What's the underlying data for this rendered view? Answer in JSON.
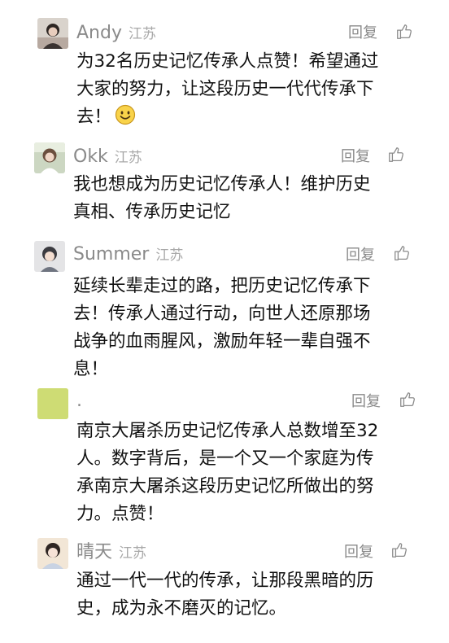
{
  "reply_label": "回复",
  "comments": [
    {
      "user": "Andy",
      "location": "江苏",
      "text_lines": [
        "为32名历史记忆传承人点赞！希望通过",
        "大家的努力，让这段历史一代代传承下",
        "去！"
      ],
      "emoji": "smiling-face"
    },
    {
      "user": "Okk",
      "location": "江苏",
      "text_lines": [
        "我也想成为历史记忆传承人！维护历史",
        "真相、传承历史记忆"
      ]
    },
    {
      "user": "Summer",
      "location": "江苏",
      "text_lines": [
        "延续长辈走过的路，把历史记忆传承下",
        "去！传承人通过行动，向世人还原那场",
        "战争的血雨腥风，激励年轻一辈自强不",
        "息！"
      ]
    },
    {
      "user": ".",
      "location": "",
      "text_lines": [
        "南京大屠杀历史记忆传承人总数增至32",
        "人。数字背后，是一个又一个家庭为传",
        "承南京大屠杀这段历史记忆所做出的努",
        "力。点赞！"
      ]
    },
    {
      "user": "晴天",
      "location": "江苏",
      "text_lines": [
        "通过一代一代的传承，让那段黑暗的历",
        "史，成为永不磨灭的记忆。"
      ]
    }
  ],
  "colors": {
    "meta": "#8a8a8a",
    "text": "#111111",
    "background": "#ffffff"
  }
}
